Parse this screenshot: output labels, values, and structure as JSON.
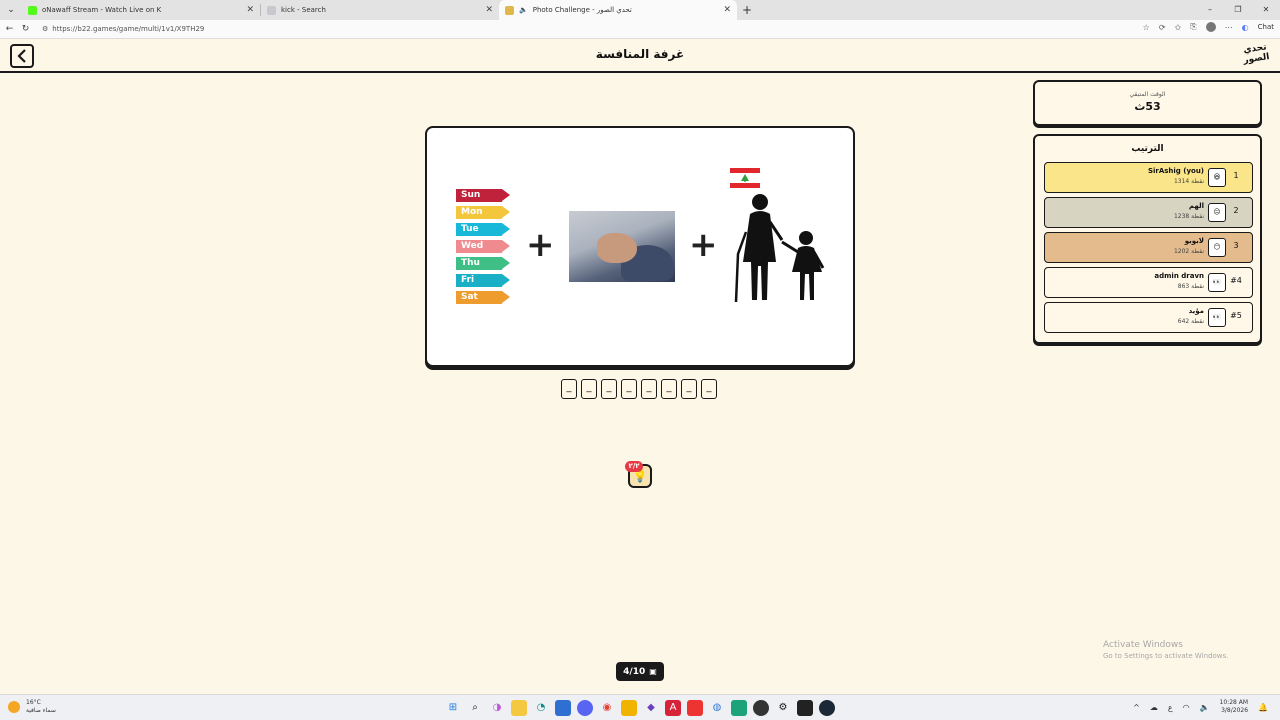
{
  "browser": {
    "tabs": [
      {
        "title": "oNawaff Stream - Watch Live on K",
        "favicon_color": "#53fc18",
        "active": false
      },
      {
        "title": "kick - Search",
        "favicon_color": "#9aa0a6",
        "active": false
      },
      {
        "title": "Photo Challenge - تحدي الصور",
        "favicon_color": "#e0b84a",
        "active": true
      }
    ],
    "url": "https://b22.games/game/multi/1v1/X9TH29",
    "chat_label": "Chat"
  },
  "page": {
    "title": "غرفة المنافسة",
    "logo_text": "تحدي الصور"
  },
  "puzzle": {
    "days": [
      {
        "label": "Sun",
        "color": "#c0213b"
      },
      {
        "label": "Mon",
        "color": "#f3c63b"
      },
      {
        "label": "Tue",
        "color": "#19b7d8"
      },
      {
        "label": "Wed",
        "color": "#ef8a8f"
      },
      {
        "label": "Thu",
        "color": "#3fbf86"
      },
      {
        "label": "Fri",
        "color": "#19b0c5"
      },
      {
        "label": "Sat",
        "color": "#ef9c2f"
      }
    ],
    "plus": "+",
    "slots": [
      "_",
      "_",
      "_",
      "_",
      "_",
      "_",
      "_",
      "_"
    ]
  },
  "hint": {
    "badge": "٢/٢",
    "icon": "lightbulb-icon"
  },
  "progress": {
    "label": "4/10",
    "icon": "image-icon"
  },
  "timer": {
    "label": "الوقت المتبقي",
    "value": "53ث"
  },
  "ranking": {
    "title": "الترتيب",
    "players": [
      {
        "rank": "1",
        "name": "SirAshig (you)",
        "score": "1314 نقطة",
        "face": "😆"
      },
      {
        "rank": "2",
        "name": "الهم",
        "score": "1238 نقطة",
        "face": "😐"
      },
      {
        "rank": "3",
        "name": "لابوبو",
        "score": "1202 نقطة",
        "face": "😶"
      },
      {
        "rank": "#4",
        "name": "admin dravn",
        "score": "863 نقطة",
        "face": "👀"
      },
      {
        "rank": "#5",
        "name": "مؤيد",
        "score": "642 نقطة",
        "face": "👀"
      }
    ]
  },
  "watermark": {
    "line1": "Activate Windows",
    "line2": "Go to Settings to activate Windows."
  },
  "taskbar": {
    "weather_temp": "16°C",
    "weather_desc": "سماء صافية",
    "time": "10:28 AM",
    "date": "3/8/2026"
  }
}
